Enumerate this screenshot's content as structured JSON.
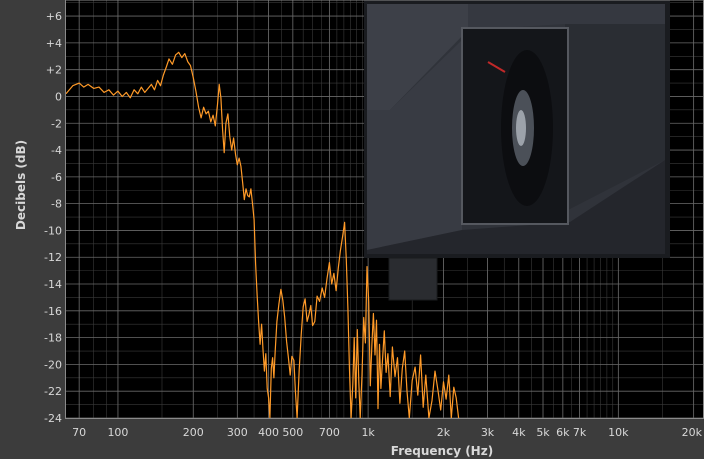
{
  "chart_data": {
    "type": "line",
    "xlabel": "Frequency (Hz)",
    "ylabel": "Decibels (dB)",
    "xscale": "log",
    "xlim": [
      62,
      22000
    ],
    "ylim": [
      -24,
      7.2
    ],
    "grid": true,
    "colors": {
      "line": "#ff9a28",
      "plot_bg": "#000000",
      "frame_bg": "#3c3c3c",
      "grid": "#6a6a6a",
      "text": "#d8d8d8"
    },
    "x_ticks": [
      {
        "value": 70,
        "label": "70"
      },
      {
        "value": 100,
        "label": "100"
      },
      {
        "value": 200,
        "label": "200"
      },
      {
        "value": 300,
        "label": "300"
      },
      {
        "value": 400,
        "label": "400"
      },
      {
        "value": 500,
        "label": "500"
      },
      {
        "value": 700,
        "label": "700"
      },
      {
        "value": 1000,
        "label": "1k"
      },
      {
        "value": 2000,
        "label": "2k"
      },
      {
        "value": 3000,
        "label": "3k"
      },
      {
        "value": 4000,
        "label": "4k"
      },
      {
        "value": 5000,
        "label": "5k"
      },
      {
        "value": 6000,
        "label": "6k"
      },
      {
        "value": 7000,
        "label": "7k"
      },
      {
        "value": 10000,
        "label": "10k"
      },
      {
        "value": 20000,
        "label": "20k"
      }
    ],
    "y_ticks": [
      {
        "value": 6,
        "label": "+6"
      },
      {
        "value": 4,
        "label": "+4"
      },
      {
        "value": 2,
        "label": "+2"
      },
      {
        "value": 0,
        "label": "0"
      },
      {
        "value": -2,
        "label": "-2"
      },
      {
        "value": -4,
        "label": "-4"
      },
      {
        "value": -6,
        "label": "-6"
      },
      {
        "value": -8,
        "label": "-8"
      },
      {
        "value": -10,
        "label": "-10"
      },
      {
        "value": -12,
        "label": "-12"
      },
      {
        "value": -14,
        "label": "-14"
      },
      {
        "value": -16,
        "label": "-16"
      },
      {
        "value": -18,
        "label": "-18"
      },
      {
        "value": -20,
        "label": "-20"
      },
      {
        "value": -22,
        "label": "-22"
      },
      {
        "value": -24,
        "label": "-24"
      }
    ],
    "series": [
      {
        "points": [
          [
            62,
            0.2
          ],
          [
            66,
            0.8
          ],
          [
            70,
            1.0
          ],
          [
            73,
            0.7
          ],
          [
            76,
            0.9
          ],
          [
            80,
            0.6
          ],
          [
            84,
            0.7
          ],
          [
            88,
            0.3
          ],
          [
            92,
            0.5
          ],
          [
            96,
            0.1
          ],
          [
            100,
            0.4
          ],
          [
            104,
            0.0
          ],
          [
            108,
            0.3
          ],
          [
            112,
            -0.1
          ],
          [
            116,
            0.5
          ],
          [
            120,
            0.2
          ],
          [
            124,
            0.7
          ],
          [
            128,
            0.3
          ],
          [
            132,
            0.6
          ],
          [
            136,
            0.9
          ],
          [
            140,
            0.5
          ],
          [
            144,
            1.2
          ],
          [
            148,
            0.8
          ],
          [
            152,
            1.6
          ],
          [
            156,
            2.2
          ],
          [
            160,
            2.8
          ],
          [
            165,
            2.4
          ],
          [
            170,
            3.1
          ],
          [
            175,
            3.3
          ],
          [
            180,
            2.9
          ],
          [
            185,
            3.2
          ],
          [
            190,
            2.6
          ],
          [
            195,
            2.3
          ],
          [
            200,
            1.4
          ],
          [
            205,
            0.4
          ],
          [
            210,
            -0.8
          ],
          [
            215,
            -1.6
          ],
          [
            220,
            -0.8
          ],
          [
            225,
            -1.3
          ],
          [
            230,
            -1.1
          ],
          [
            235,
            -1.9
          ],
          [
            240,
            -1.4
          ],
          [
            245,
            -2.2
          ],
          [
            250,
            -0.6
          ],
          [
            254,
            0.9
          ],
          [
            258,
            -0.1
          ],
          [
            262,
            -2.5
          ],
          [
            266,
            -4.2
          ],
          [
            270,
            -2.0
          ],
          [
            275,
            -1.3
          ],
          [
            280,
            -3.0
          ],
          [
            285,
            -4.0
          ],
          [
            290,
            -3.1
          ],
          [
            295,
            -4.3
          ],
          [
            300,
            -5.1
          ],
          [
            305,
            -4.6
          ],
          [
            310,
            -5.2
          ],
          [
            315,
            -6.4
          ],
          [
            320,
            -7.7
          ],
          [
            325,
            -6.9
          ],
          [
            330,
            -7.4
          ],
          [
            335,
            -7.5
          ],
          [
            340,
            -6.9
          ],
          [
            345,
            -8.0
          ],
          [
            350,
            -9.2
          ],
          [
            355,
            -12.5
          ],
          [
            360,
            -14.8
          ],
          [
            365,
            -16.8
          ],
          [
            370,
            -18.5
          ],
          [
            375,
            -17.0
          ],
          [
            380,
            -18.9
          ],
          [
            385,
            -20.5
          ],
          [
            390,
            -19.2
          ],
          [
            395,
            -21.8
          ],
          [
            400,
            -22.5
          ],
          [
            405,
            -24.0
          ],
          [
            410,
            -20.3
          ],
          [
            415,
            -19.5
          ],
          [
            420,
            -21.0
          ],
          [
            425,
            -19.0
          ],
          [
            432,
            -16.8
          ],
          [
            440,
            -15.5
          ],
          [
            448,
            -14.4
          ],
          [
            456,
            -15.2
          ],
          [
            464,
            -16.5
          ],
          [
            472,
            -18.3
          ],
          [
            480,
            -19.5
          ],
          [
            488,
            -20.8
          ],
          [
            496,
            -19.4
          ],
          [
            505,
            -19.7
          ],
          [
            512,
            -22.0
          ],
          [
            520,
            -24.0
          ],
          [
            530,
            -20.4
          ],
          [
            540,
            -17.8
          ],
          [
            550,
            -15.7
          ],
          [
            560,
            -15.1
          ],
          [
            570,
            -16.8
          ],
          [
            580,
            -16.3
          ],
          [
            590,
            -15.6
          ],
          [
            600,
            -17.1
          ],
          [
            612,
            -16.8
          ],
          [
            625,
            -14.9
          ],
          [
            640,
            -15.3
          ],
          [
            655,
            -14.3
          ],
          [
            670,
            -15.0
          ],
          [
            685,
            -13.6
          ],
          [
            700,
            -12.4
          ],
          [
            715,
            -14.0
          ],
          [
            730,
            -13.2
          ],
          [
            745,
            -14.5
          ],
          [
            760,
            -12.8
          ],
          [
            775,
            -11.5
          ],
          [
            790,
            -10.5
          ],
          [
            805,
            -9.4
          ],
          [
            818,
            -12.2
          ],
          [
            830,
            -15.8
          ],
          [
            842,
            -20.2
          ],
          [
            855,
            -24.0
          ],
          [
            868,
            -21.5
          ],
          [
            880,
            -18.0
          ],
          [
            892,
            -22.5
          ],
          [
            905,
            -17.4
          ],
          [
            918,
            -21.3
          ],
          [
            930,
            -24.0
          ],
          [
            945,
            -20.8
          ],
          [
            960,
            -16.5
          ],
          [
            975,
            -18.4
          ],
          [
            990,
            -12.7
          ],
          [
            1005,
            -15.3
          ],
          [
            1020,
            -21.6
          ],
          [
            1035,
            -18.5
          ],
          [
            1050,
            -16.2
          ],
          [
            1065,
            -19.3
          ],
          [
            1080,
            -16.7
          ],
          [
            1095,
            -23.3
          ],
          [
            1110,
            -18.5
          ],
          [
            1125,
            -21.8
          ],
          [
            1140,
            -19.8
          ],
          [
            1160,
            -17.5
          ],
          [
            1180,
            -20.6
          ],
          [
            1200,
            -19.2
          ],
          [
            1225,
            -22.4
          ],
          [
            1250,
            -18.7
          ],
          [
            1280,
            -20.9
          ],
          [
            1310,
            -19.5
          ],
          [
            1340,
            -22.9
          ],
          [
            1370,
            -20.3
          ],
          [
            1400,
            -19.0
          ],
          [
            1430,
            -22.0
          ],
          [
            1460,
            -24.0
          ],
          [
            1500,
            -21.2
          ],
          [
            1540,
            -20.2
          ],
          [
            1580,
            -22.3
          ],
          [
            1620,
            -19.3
          ],
          [
            1660,
            -23.2
          ],
          [
            1700,
            -20.8
          ],
          [
            1750,
            -24.0
          ],
          [
            1800,
            -22.7
          ],
          [
            1850,
            -20.5
          ],
          [
            1900,
            -21.9
          ],
          [
            1950,
            -23.4
          ],
          [
            2000,
            -21.3
          ],
          [
            2050,
            -22.6
          ],
          [
            2100,
            -20.8
          ],
          [
            2150,
            -24.0
          ],
          [
            2200,
            -21.7
          ],
          [
            2250,
            -22.5
          ],
          [
            2300,
            -24.0
          ]
        ]
      }
    ]
  }
}
